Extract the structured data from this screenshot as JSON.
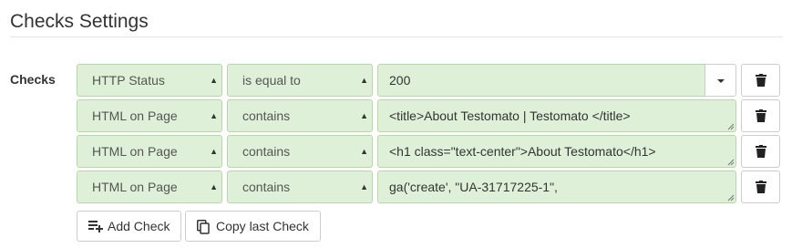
{
  "page": {
    "title": "Checks Settings"
  },
  "checks": {
    "label": "Checks",
    "rows": [
      {
        "type": "HTTP Status",
        "operator": "is equal to",
        "value": "200"
      },
      {
        "type": "HTML on Page",
        "operator": "contains",
        "value": "<title>About Testomato | Testomato </title>"
      },
      {
        "type": "HTML on Page",
        "operator": "contains",
        "value": "<h1 class=\"text-center\">About Testomato</h1>"
      },
      {
        "type": "HTML on Page",
        "operator": "contains",
        "value": "ga('create', \"UA-31717225-1\","
      }
    ]
  },
  "actions": {
    "add_label": "Add Check",
    "copy_label": "Copy last Check"
  },
  "colors": {
    "field_bg": "#dff0d8",
    "field_border": "#b2dba1",
    "text": "#333333"
  },
  "icons": {
    "delete": "trash-icon",
    "add": "playlist-add-icon",
    "copy": "copy-icon",
    "dropdown": "caret-down-icon"
  }
}
